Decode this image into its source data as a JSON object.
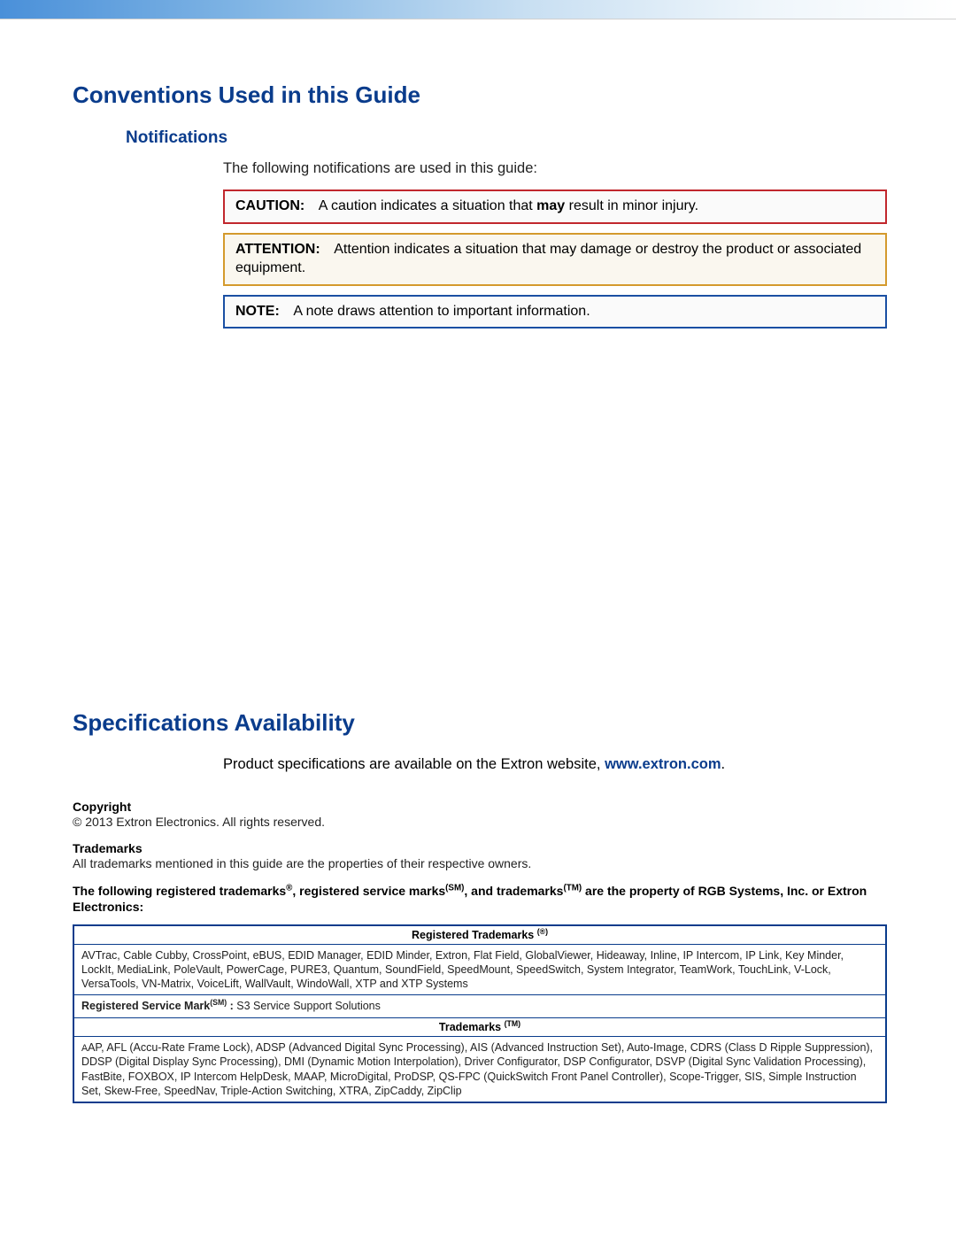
{
  "section1": {
    "title": "Conventions Used in this Guide",
    "sub": "Notifications",
    "intro": "The following notifications are used in this guide:",
    "caution": {
      "label": "CAUTION:",
      "pre": "A caution indicates a situation that ",
      "bold": "may",
      "post": " result in minor injury."
    },
    "attention": {
      "label": "ATTENTION:",
      "text": "Attention indicates a situation that may damage or destroy the product or associated equipment."
    },
    "note": {
      "label": "NOTE:",
      "text": "A note draws attention to important information."
    }
  },
  "section2": {
    "title": "Specifications Availability",
    "intro_pre": "Product specifications are available on the Extron website, ",
    "intro_link": "www.extron.com",
    "intro_post": ".",
    "copyright_head": "Copyright",
    "copyright_body": "© 2013 Extron Electronics. All rights reserved.",
    "trademarks_head": "Trademarks",
    "trademarks_body": "All trademarks mentioned in this guide are the properties of their respective owners.",
    "tm_statement_pre": "The following registered trademarks",
    "reg_sup": "®",
    "tm_statement_mid1": ", registered service marks",
    "sm_sup": "(SM)",
    "tm_statement_mid2": ", and trademarks",
    "tm_sup": "(TM)",
    "tm_statement_post": " are the property of RGB Systems, Inc. or Extron Electronics:",
    "table": {
      "reg_header_pre": "Registered Trademarks ",
      "reg_header_sup": "(®)",
      "reg_body": "AVTrac, Cable Cubby, CrossPoint, eBUS, EDID Manager, EDID Minder, Extron, Flat Field, GlobalViewer, Hideaway, Inline, IP Intercom, IP Link, Key Minder, LockIt, MediaLink, PoleVault, PowerCage, PURE3, Quantum, SoundField, SpeedMount, SpeedSwitch, System Integrator, TeamWork, TouchLink, V-Lock, VersaTools, VN-Matrix,  VoiceLift, WallVault, WindoWall, XTP and XTP Systems",
      "svc_label_pre": "Registered Service Mark",
      "svc_label_sup": "(SM)",
      "svc_label_post": " :",
      "svc_body": "  S3 Service Support Solutions",
      "tm_header_pre": "Trademarks ",
      "tm_header_sup": "(TM)",
      "tm_body_firstchar": "A",
      "tm_body": "AP, AFL (Accu-Rate Frame Lock), ADSP (Advanced Digital Sync Processing), AIS (Advanced Instruction Set), Auto-Image, CDRS (Class D Ripple Suppression), DDSP (Digital Display Sync Processing), DMI (Dynamic Motion Interpolation), Driver Configurator, DSP Configurator, DSVP (Digital Sync Validation Processing), FastBite, FOXBOX, IP Intercom HelpDesk, MAAP, MicroDigital, ProDSP, QS-FPC (QuickSwitch Front Panel Controller), Scope-Trigger, SIS, Simple Instruction Set, Skew-Free, SpeedNav, Triple-Action Switching, XTRA, ZipCaddy, ZipClip"
    }
  }
}
